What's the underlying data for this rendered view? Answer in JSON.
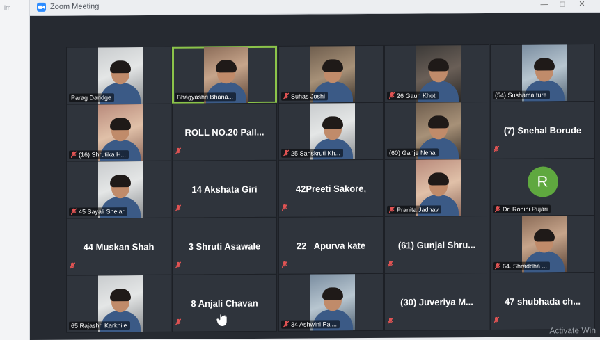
{
  "left_strip_label": "im",
  "window": {
    "title": "Zoom Meeting"
  },
  "participants": [
    {
      "name": "Parag Dandge"
    },
    {
      "name": "Bhagyashri Bhana..."
    },
    {
      "name": "Suhas Joshi"
    },
    {
      "name": "26 Gauri Khot"
    },
    {
      "name": "(54) Sushama ture"
    },
    {
      "name": "(16) Shrutika H..."
    },
    {
      "name": "ROLL NO.20 Pall..."
    },
    {
      "name": "25 Sanskruti Kh..."
    },
    {
      "name": "(60) Ganje Neha"
    },
    {
      "name": "(7) Snehal Borude"
    },
    {
      "name": "45 Sayali Shelar"
    },
    {
      "name": "14 Akshata Giri"
    },
    {
      "name": "42Preeti Sakore,"
    },
    {
      "name": "Pranita Jadhav"
    },
    {
      "name": "Dr. Rohini Pujari",
      "avatar_letter": "R"
    },
    {
      "name": "44 Muskan Shah"
    },
    {
      "name": "3 Shruti Asawale"
    },
    {
      "name": "22_ Apurva kate"
    },
    {
      "name": "(61) Gunjal Shru..."
    },
    {
      "name": "64. Shraddha ..."
    },
    {
      "name": "65 Rajashri Karkhile"
    },
    {
      "name": "8 Anjali Chavan"
    },
    {
      "name": "34 Ashwini Pal..."
    },
    {
      "name": "(30) Juveriya M..."
    },
    {
      "name": "47 shubhada ch..."
    }
  ],
  "watermark": "Activate Win",
  "colors": {
    "active_speaker_border": "#8bc34a",
    "avatar_bg": "#5fa83f",
    "muted_icon": "#e05353"
  }
}
